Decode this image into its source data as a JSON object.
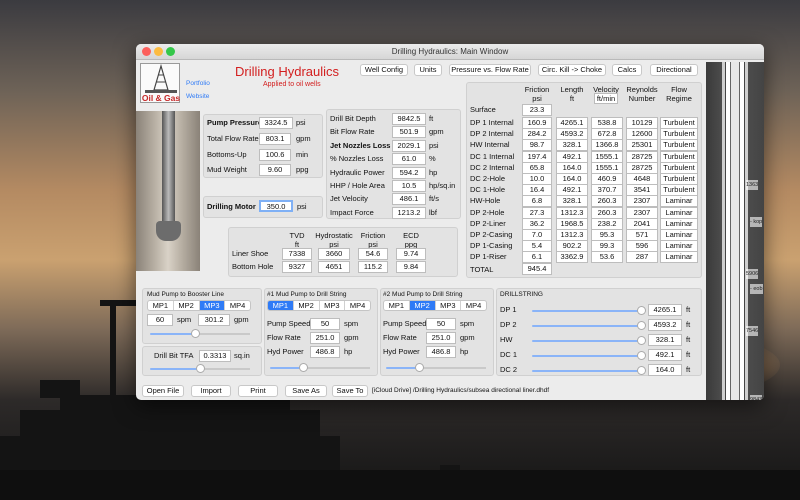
{
  "window": {
    "title": "Drilling Hydraulics: Main Window"
  },
  "logo": {
    "text": "Oil & Gas"
  },
  "links": {
    "portfolio": "Portfolio",
    "website": "Website"
  },
  "app": {
    "title": "Drilling Hydraulics",
    "subtitle": "Applied to oil wells"
  },
  "toolbar": {
    "well_config": "Well Config",
    "units": "Units",
    "pvf": "Pressure vs. Flow Rate",
    "circ": "Circ. Kill -> Choke",
    "calcs": "Calcs",
    "directional": "Directional"
  },
  "pump": {
    "pressure": {
      "label": "Pump Pressure",
      "value": "3324.5",
      "unit": "psi"
    },
    "flow": {
      "label": "Total Flow Rate",
      "value": "803.1",
      "unit": "gpm"
    },
    "bottoms": {
      "label": "Bottoms-Up",
      "value": "100.6",
      "unit": "min"
    },
    "mud": {
      "label": "Mud Weight",
      "value": "9.60",
      "unit": "ppg"
    },
    "motor": {
      "label": "Drilling Motor",
      "value": "350.0",
      "unit": "psi"
    }
  },
  "bit": {
    "depth": {
      "label": "Drill Bit Depth",
      "value": "9842.5",
      "unit": "ft"
    },
    "flow": {
      "label": "Bit Flow Rate",
      "value": "501.9",
      "unit": "gpm"
    },
    "jet_loss": {
      "label": "Jet Nozzles Loss",
      "value": "2029.1",
      "unit": "psi"
    },
    "pct_loss": {
      "label": "% Nozzles Loss",
      "value": "61.0",
      "unit": "%"
    },
    "hp": {
      "label": "Hydraulic Power",
      "value": "594.2",
      "unit": "hp"
    },
    "hhp": {
      "label": "HHP / Hole Area",
      "value": "10.5",
      "unit": "hp/sq.in"
    },
    "jetvel": {
      "label": "Jet Velocity",
      "value": "486.1",
      "unit": "ft/s"
    },
    "impact": {
      "label": "Impact Force",
      "value": "1213.2",
      "unit": "lbf"
    }
  },
  "ecd": {
    "headers": {
      "tvd": "TVD",
      "tvd_u": "ft",
      "hyd": "Hydrostatic",
      "hyd_u": "psi",
      "fric": "Friction",
      "fric_u": "psi",
      "ecd": "ECD",
      "ecd_u": "ppg"
    },
    "rows": [
      {
        "label": "Liner Shoe",
        "tvd": "7338",
        "hyd": "3660",
        "fric": "54.6",
        "ecd": "9.74"
      },
      {
        "label": "Bottom Hole",
        "tvd": "9327",
        "hyd": "4651",
        "fric": "115.2",
        "ecd": "9.84"
      }
    ]
  },
  "friction": {
    "headers": {
      "fric": "Friction",
      "fric_u": "psi",
      "len": "Length",
      "len_u": "ft",
      "vel": "Velocity",
      "vel_u": "ft/min",
      "rey": "Reynolds",
      "rey_u": "Number",
      "flow": "Flow",
      "flow_u": "Regime"
    },
    "surface": {
      "label": "Surface",
      "value": "23.3"
    },
    "rows": [
      {
        "label": "DP 1 Internal",
        "fric": "160.9",
        "len": "4265.1",
        "vel": "538.8",
        "rey": "10129",
        "regime": "Turbulent"
      },
      {
        "label": "DP 2 Internal",
        "fric": "284.2",
        "len": "4593.2",
        "vel": "672.8",
        "rey": "12600",
        "regime": "Turbulent"
      },
      {
        "label": "HW Internal",
        "fric": "98.7",
        "len": "328.1",
        "vel": "1366.8",
        "rey": "25301",
        "regime": "Turbulent"
      },
      {
        "label": "DC 1 Internal",
        "fric": "197.4",
        "len": "492.1",
        "vel": "1555.1",
        "rey": "28725",
        "regime": "Turbulent"
      },
      {
        "label": "DC 2 Internal",
        "fric": "65.8",
        "len": "164.0",
        "vel": "1555.1",
        "rey": "28725",
        "regime": "Turbulent"
      },
      {
        "label": "DC 2-Hole",
        "fric": "10.0",
        "len": "164.0",
        "vel": "460.9",
        "rey": "4648",
        "regime": "Turbulent"
      },
      {
        "label": "DC 1-Hole",
        "fric": "16.4",
        "len": "492.1",
        "vel": "370.7",
        "rey": "3541",
        "regime": "Turbulent"
      },
      {
        "label": "HW-Hole",
        "fric": "6.8",
        "len": "328.1",
        "vel": "260.3",
        "rey": "2307",
        "regime": "Laminar"
      },
      {
        "label": "DP 2-Hole",
        "fric": "27.3",
        "len": "1312.3",
        "vel": "260.3",
        "rey": "2307",
        "regime": "Laminar"
      },
      {
        "label": "DP 2-Liner",
        "fric": "36.2",
        "len": "1968.5",
        "vel": "238.2",
        "rey": "2041",
        "regime": "Laminar"
      },
      {
        "label": "DP 2-Casing",
        "fric": "7.0",
        "len": "1312.3",
        "vel": "95.3",
        "rey": "571",
        "regime": "Laminar"
      },
      {
        "label": "DP 1-Casing",
        "fric": "5.4",
        "len": "902.2",
        "vel": "99.3",
        "rey": "596",
        "regime": "Laminar"
      },
      {
        "label": "DP 1-Riser",
        "fric": "6.1",
        "len": "3362.9",
        "vel": "53.6",
        "rey": "287",
        "regime": "Laminar"
      }
    ],
    "total": {
      "label": "TOTAL",
      "value": "945.4"
    }
  },
  "booster": {
    "title": "Mud Pump to Booster Line",
    "segments": [
      "MP1",
      "MP2",
      "MP3",
      "MP4"
    ],
    "selected": 2,
    "spm": "60",
    "spm_u": "spm",
    "gpm": "301.2",
    "gpm_u": "gpm",
    "slider": 0.45
  },
  "bit_tfa": {
    "label": "Drill Bit TFA",
    "value": "0.3313",
    "unit": "sq.in",
    "slider": 0.5
  },
  "mp1": {
    "title": "#1 Mud Pump to Drill String",
    "segments": [
      "MP1",
      "MP2",
      "MP3",
      "MP4"
    ],
    "selected": 0,
    "speed": {
      "label": "Pump Speed",
      "value": "50",
      "unit": "spm"
    },
    "flow": {
      "label": "Flow Rate",
      "value": "251.0",
      "unit": "gpm"
    },
    "power": {
      "label": "Hyd Power",
      "value": "486.8",
      "unit": "hp"
    },
    "slider": 0.33
  },
  "mp2": {
    "title": "#2 Mud Pump to Drill String",
    "segments": [
      "MP1",
      "MP2",
      "MP3",
      "MP4"
    ],
    "selected": 1,
    "speed": {
      "label": "Pump Speed",
      "value": "50",
      "unit": "spm"
    },
    "flow": {
      "label": "Flow Rate",
      "value": "251.0",
      "unit": "gpm"
    },
    "power": {
      "label": "Hyd Power",
      "value": "486.8",
      "unit": "hp"
    },
    "slider": 0.33
  },
  "drillstring": {
    "title": "DRILLSTRING",
    "unit": "ft",
    "items": [
      {
        "label": "DP 1",
        "value": "4265.1",
        "slider": 0.99
      },
      {
        "label": "DP 2",
        "value": "4593.2",
        "slider": 0.99
      },
      {
        "label": "HW",
        "value": "328.1",
        "slider": 0.99
      },
      {
        "label": "DC 1",
        "value": "492.1",
        "slider": 0.99
      },
      {
        "label": "DC 2",
        "value": "164.0",
        "slider": 0.99
      }
    ]
  },
  "bottom": {
    "open": "Open File",
    "import": "Import",
    "print": "Print",
    "save_as": "Save As",
    "save_to": "Save To",
    "path": "[iCloud Drive] /Drilling Hydraulics/subsea directional liner.dhdf"
  },
  "wellbore": {
    "labels": [
      "1363",
      "- kop",
      "5906",
      "- eob",
      "7546",
      "9843"
    ]
  }
}
